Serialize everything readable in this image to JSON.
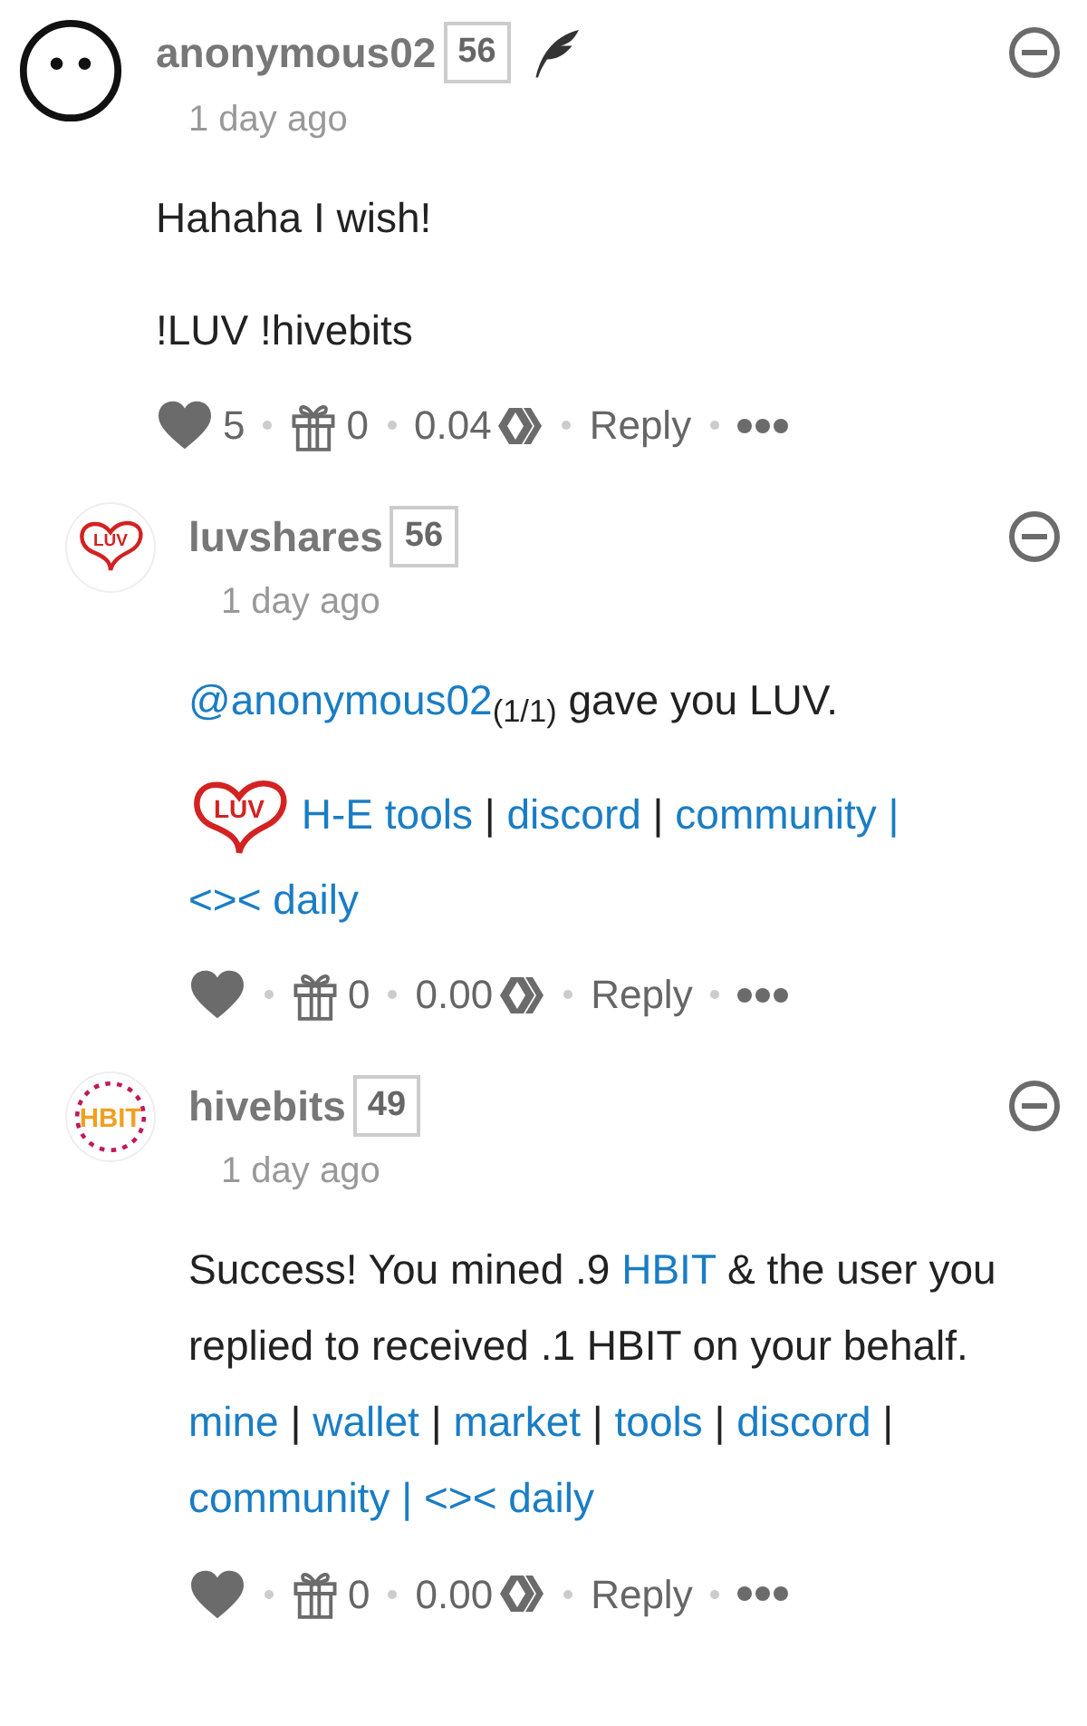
{
  "comments": [
    {
      "avatar": {
        "kind": "face"
      },
      "author": "anonymous02",
      "reputation": "56",
      "feather": true,
      "nested": false,
      "time": "1 day ago",
      "body": [
        [
          {
            "kind": "text",
            "text": "Hahaha I wish!"
          }
        ],
        [
          {
            "kind": "text",
            "text": "!LUV !hivebits"
          }
        ]
      ],
      "actions": {
        "votes": "5",
        "gifts": "0",
        "payout": "0.04",
        "reply": "Reply"
      }
    },
    {
      "avatar": {
        "kind": "luv",
        "label": "LUV"
      },
      "author": "luvshares",
      "reputation": "56",
      "feather": false,
      "nested": true,
      "time": "1 day ago",
      "body": [
        [
          {
            "kind": "link",
            "text": "@anonymous02"
          },
          {
            "kind": "text",
            "text": "$_{(1/1)}$ gave you LUV."
          }
        ],
        [
          {
            "kind": "logo",
            "text": "LUV"
          },
          {
            "kind": "space"
          },
          {
            "kind": "link",
            "text": "H-E tools"
          },
          {
            "kind": "text",
            "text": " | "
          },
          {
            "kind": "link",
            "text": "discord"
          },
          {
            "kind": "text",
            "text": " | "
          },
          {
            "kind": "link",
            "text": "community |"
          },
          {
            "kind": "space"
          },
          {
            "kind": "link",
            "text": "<>< daily"
          }
        ]
      ],
      "actions": {
        "gifts": "0",
        "payout": "0.00",
        "reply": "Reply"
      }
    },
    {
      "avatar": {
        "kind": "hbit",
        "label": "HBIT"
      },
      "author": "hivebits",
      "reputation": "49",
      "feather": false,
      "nested": true,
      "time": "1 day ago",
      "body": [
        [
          {
            "kind": "text",
            "text": "Success! You mined .9 "
          },
          {
            "kind": "link",
            "text": "HBIT"
          },
          {
            "kind": "text",
            "text": " & the user you replied to received .1 HBIT on your behalf. "
          },
          {
            "kind": "link",
            "text": "mine"
          },
          {
            "kind": "text",
            "text": " | "
          },
          {
            "kind": "link",
            "text": "wallet"
          },
          {
            "kind": "text",
            "text": " | "
          },
          {
            "kind": "link",
            "text": "market"
          },
          {
            "kind": "text",
            "text": " | "
          },
          {
            "kind": "link",
            "text": "tools"
          },
          {
            "kind": "text",
            "text": " | "
          },
          {
            "kind": "link",
            "text": "discord"
          },
          {
            "kind": "text",
            "text": " | "
          },
          {
            "kind": "link",
            "text": "community |"
          },
          {
            "kind": "space"
          },
          {
            "kind": "link",
            "text": "<>< daily"
          }
        ]
      ],
      "actions": {
        "gifts": "0",
        "payout": "0.00",
        "reply": "Reply"
      }
    }
  ]
}
